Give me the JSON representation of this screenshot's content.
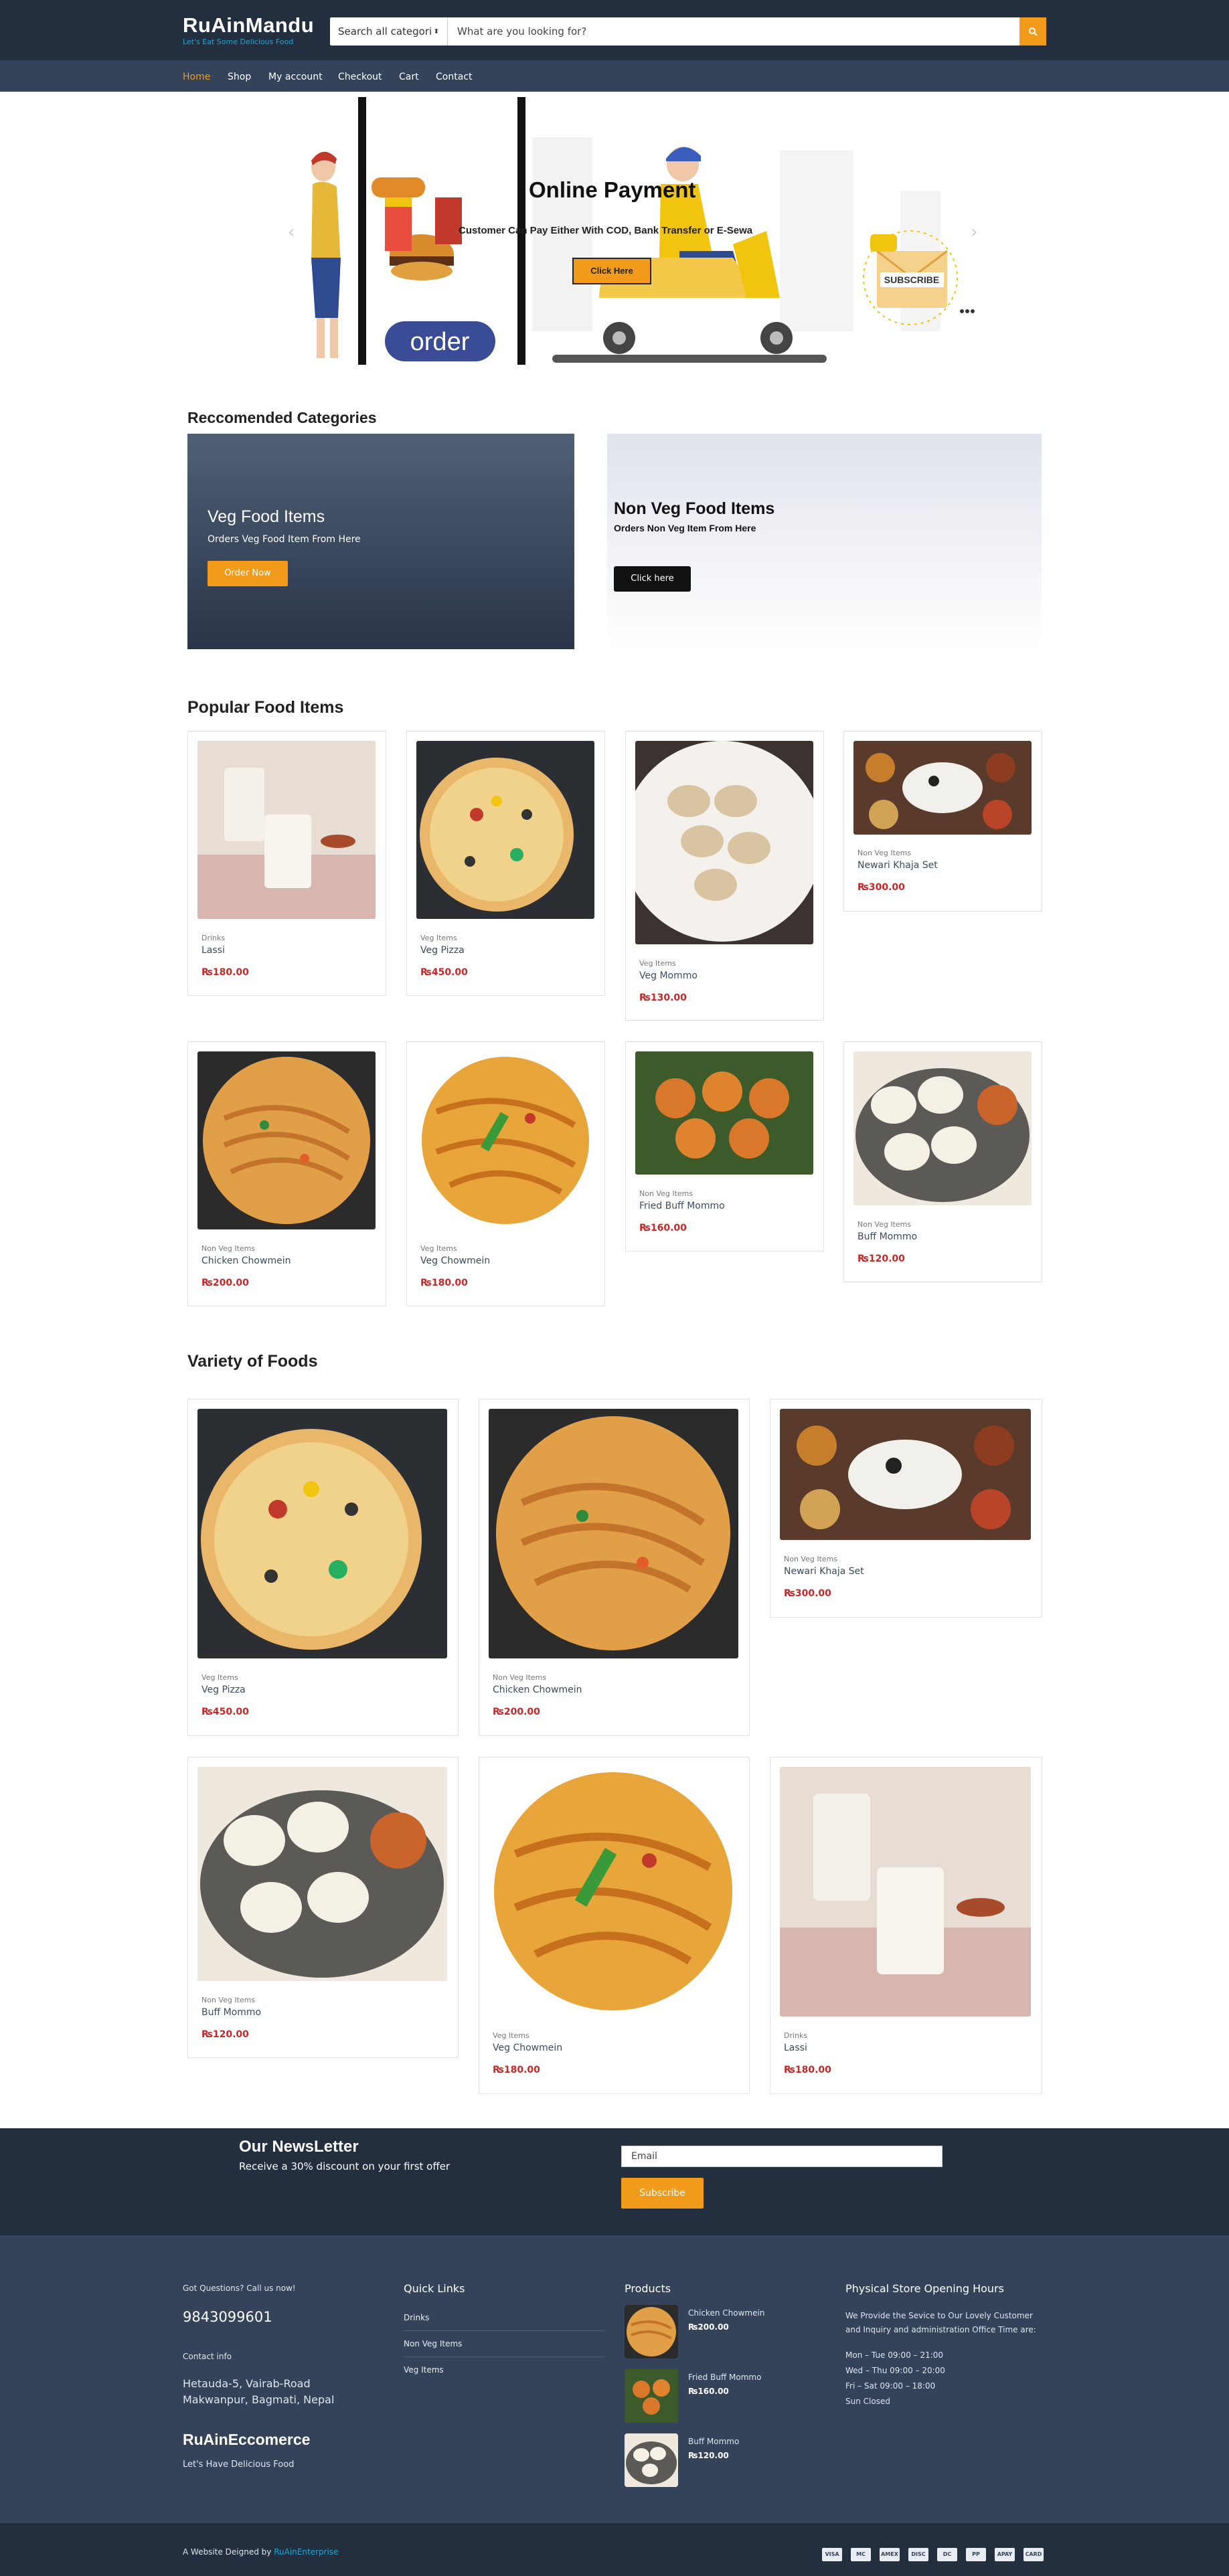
{
  "brand": {
    "name": "RuAinMandu",
    "tagline": "Let's Eat Some Delicious Food"
  },
  "search": {
    "category": "Search all categori",
    "placeholder": "What are you looking for?"
  },
  "nav": [
    "Home",
    "Shop",
    "My account",
    "Checkout",
    "Cart",
    "Contact"
  ],
  "hero": {
    "title": "Online Payment",
    "subtitle": "Customer Can Pay Either With COD, Bank Transfer or E-Sewa",
    "button": "Click Here",
    "order": "order",
    "subscribe": "SUBSCRIBE"
  },
  "categories": {
    "title": "Reccomended Categories",
    "veg": {
      "title": "Veg Food Items",
      "subtitle": "Orders Veg Food Item From Here",
      "button": "Order Now"
    },
    "nonveg": {
      "title": "Non Veg Food Items",
      "subtitle": "Orders Non Veg Item From Here",
      "button": "Click here"
    }
  },
  "popular": {
    "title": "Popular Food Items",
    "items": [
      {
        "cat": "Drinks",
        "name": "Lassi",
        "price": "₨180.00"
      },
      {
        "cat": "Veg Items",
        "name": "Veg Pizza",
        "price": "₨450.00"
      },
      {
        "cat": "Veg Items",
        "name": "Veg Mommo",
        "price": "₨130.00"
      },
      {
        "cat": "Non Veg Items",
        "name": "Newari Khaja Set",
        "price": "₨300.00"
      },
      {
        "cat": "Non Veg Items",
        "name": "Chicken Chowmein",
        "price": "₨200.00"
      },
      {
        "cat": "Veg Items",
        "name": "Veg Chowmein",
        "price": "₨180.00"
      },
      {
        "cat": "Non Veg Items",
        "name": "Fried Buff Mommo",
        "price": "₨160.00"
      },
      {
        "cat": "Non Veg Items",
        "name": "Buff Mommo",
        "price": "₨120.00"
      }
    ]
  },
  "variety": {
    "title": "Variety of Foods",
    "items": [
      {
        "cat": "Veg Items",
        "name": "Veg Pizza",
        "price": "₨450.00"
      },
      {
        "cat": "Non Veg Items",
        "name": "Chicken Chowmein",
        "price": "₨200.00"
      },
      {
        "cat": "Non Veg Items",
        "name": "Newari Khaja Set",
        "price": "₨300.00"
      },
      {
        "cat": "Non Veg Items",
        "name": "Buff Mommo",
        "price": "₨120.00"
      },
      {
        "cat": "Veg Items",
        "name": "Veg Chowmein",
        "price": "₨180.00"
      },
      {
        "cat": "Drinks",
        "name": "Lassi",
        "price": "₨180.00"
      }
    ]
  },
  "newsletter": {
    "title": "Our NewsLetter",
    "subtitle": "Receive a 30% discount on your first offer",
    "placeholder": "Email",
    "button": "Subscribe"
  },
  "footer": {
    "questions": "Got Questions? Call us now!",
    "phone": "9843099601",
    "contact_title": "Contact info",
    "address1": "Hetauda-5, Vairab-Road",
    "address2": "Makwanpur, Bagmati, Nepal",
    "company": "RuAinEccomerce",
    "company_tag": "Let's Have Delicious Food",
    "quick_title": "Quick Links",
    "quick_links": [
      "Drinks",
      "Non Veg Items",
      "Veg Items"
    ],
    "products_title": "Products",
    "products": [
      {
        "name": "Chicken Chowmein",
        "price": "₨200.00"
      },
      {
        "name": "Fried Buff Mommo",
        "price": "₨160.00"
      },
      {
        "name": "Buff Mommo",
        "price": "₨120.00"
      }
    ],
    "hours_title": "Physical Store Opening Hours",
    "hours_desc": "We Provide the Sevice to Our Lovely Customer and Inquiry and administration Office Time are:",
    "hours": [
      "Mon – Tue 09:00 – 21:00",
      "Wed – Thu 09:00 – 20:00",
      "Fri – Sat 09:00 – 18:00",
      "Sun Closed"
    ],
    "designed": "A Website Deigned by",
    "designer": "RuAinEnterprise",
    "payments": [
      "VISA",
      "MC",
      "AMEX",
      "DISC",
      "DC",
      "PP",
      "APAY",
      "CARD"
    ]
  },
  "colors": {
    "header": "#232f3e",
    "nav": "#34435a",
    "accent": "#f29b1a",
    "link": "#1ea7d8",
    "price": "#c62828"
  }
}
